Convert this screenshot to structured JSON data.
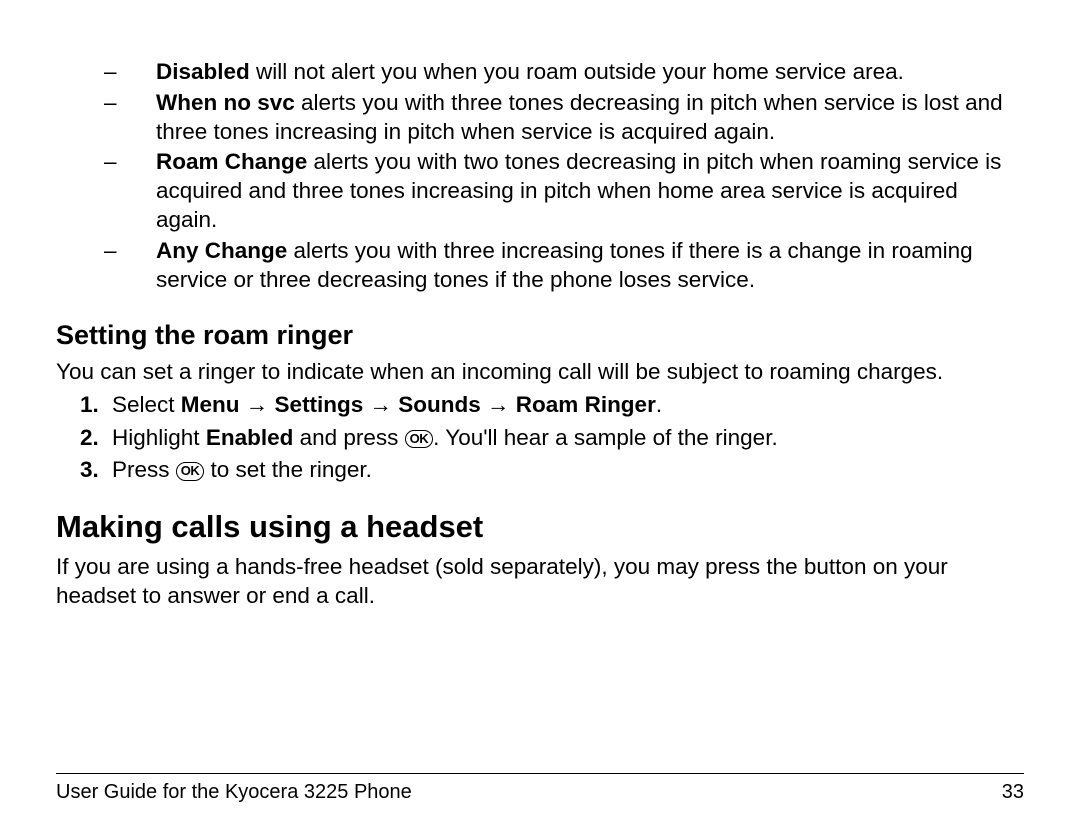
{
  "bullets": [
    {
      "bold": "Disabled",
      "rest": " will not alert you when you roam outside your home service area."
    },
    {
      "bold": "When no svc",
      "rest": " alerts you with three tones decreasing in pitch when service is lost and three tones increasing in pitch when service is acquired again."
    },
    {
      "bold": "Roam Change",
      "rest": " alerts you with two tones decreasing in pitch when roaming service is acquired and three tones increasing in pitch when home area service is acquired again."
    },
    {
      "bold": "Any Change",
      "rest": " alerts you with three increasing tones if there is a change in roaming service or three decreasing tones if the phone loses service."
    }
  ],
  "h2": "Setting the roam ringer",
  "h2_body": "You can set a ringer to indicate when an incoming call will be subject to roaming charges.",
  "steps": {
    "s1_pre": "Select ",
    "s1_bold": "Menu → Settings → Sounds → Roam Ringer",
    "s1_post": ".",
    "s2_pre": "Highlight ",
    "s2_bold": "Enabled",
    "s2_mid": " and press ",
    "s2_post": ". You'll hear a sample of the ringer.",
    "s3_pre": "Press ",
    "s3_post": " to set the ringer."
  },
  "ok_label": "OK",
  "h1": "Making calls using a headset",
  "h1_body": "If you are using a hands-free headset (sold separately), you may press the button on your headset to answer or end a call.",
  "footer_left": "User Guide for the Kyocera 3225 Phone",
  "footer_right": "33"
}
